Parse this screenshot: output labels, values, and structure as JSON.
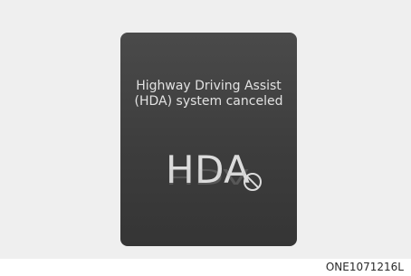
{
  "message": {
    "line1": "Highway Driving Assist",
    "line2": "(HDA) system canceled"
  },
  "indicator": {
    "text": "HDA",
    "icon": "cancel-icon"
  },
  "caption": "ONE1071216L",
  "colors": {
    "background": "#efefef",
    "display": "#404040",
    "text": "#e2e2e2"
  }
}
